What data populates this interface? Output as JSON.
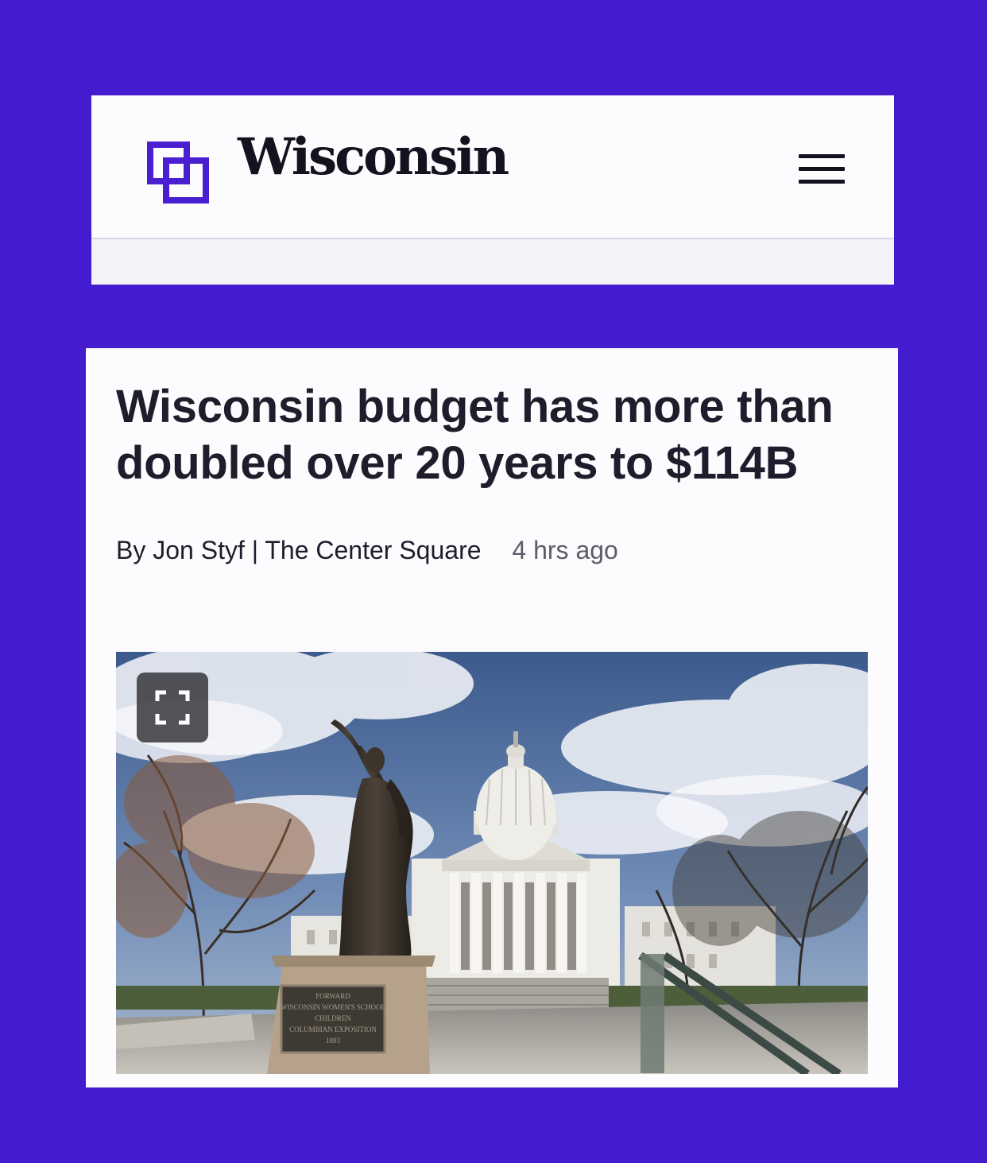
{
  "header": {
    "logo_icon": "overlapping-squares-logo-icon",
    "site_name": "Wisconsin",
    "menu_icon": "hamburger-menu-icon"
  },
  "article": {
    "headline": "Wisconsin budget has more than doubled over 20 years to $114B",
    "byline": "By Jon Styf | The Center Square",
    "timestamp": "4 hrs ago",
    "photo": {
      "expand_icon": "expand-fullscreen-icon",
      "plaque_lines": [
        "FORWARD",
        "WISCONSIN WOMEN'S SCHOOL",
        "CHILDREN",
        "COLUMBIAN EXPOSITION",
        "1893"
      ]
    }
  },
  "colors": {
    "page_background": "#451bcf",
    "brand_accent": "#4a1fd1",
    "header_background": "#fcfbfe",
    "text_primary": "#1f1d2b",
    "text_secondary": "#5e5c6a"
  }
}
